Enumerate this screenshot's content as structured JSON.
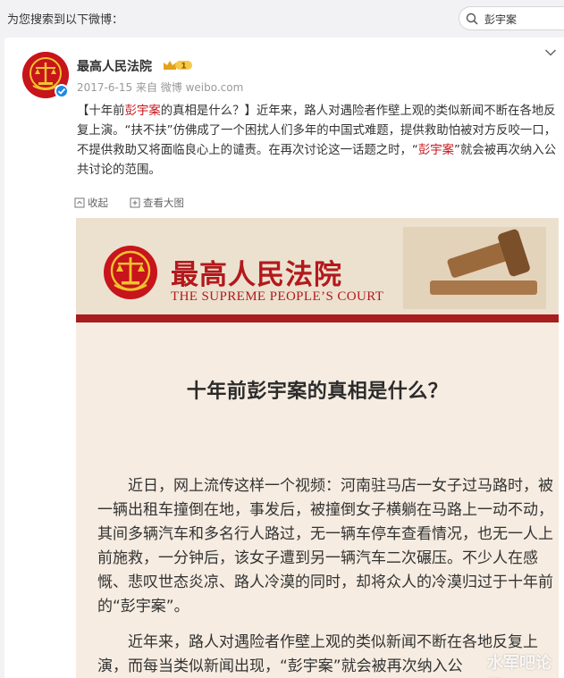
{
  "top_bar": {
    "label": "为您搜索到以下微博：",
    "search_value": "彭宇案"
  },
  "post": {
    "username": "最高人民法院",
    "badge_level": "1",
    "date": "2017-6-15",
    "source": "来自 微博 weibo.com",
    "text_segments": [
      "【十年前",
      "彭宇案",
      "的真相是什么？】近年来，路人对遇险者作壁上观的类似新闻不断在各地反复上演。“扶不扶”仿佛成了一个困扰人们多年的中国式难题，提供救助怕被对方反咬一口，不提供救助又将面临良心上的谴责。在再次讨论这一话题之时，“",
      "彭宇案",
      "”就会被再次纳入公共讨论的范围。"
    ],
    "actions": {
      "collapse": "收起",
      "view_large": "查看大图"
    }
  },
  "article_image": {
    "court_cn": "最高人民法院",
    "court_en": "THE SUPREME PEOPLE’S COURT",
    "title": "十年前彭宇案的真相是什么？",
    "para1": "近日，网上流传这样一个视频：河南驻马店一女子过马路时，被一辆出租车撞倒在地，事发后，被撞倒女子横躺在马路上一动不动，其间多辆汽车和多名行人路过，无一辆车停车查看情况，也无一人上前施救，一分钟后，该女子遭到另一辆汽车二次碾压。不少人在感慨、悲叹世态炎凉、路人冷漠的同时，却将众人的冷漠归过于十年前的“彭宇案”。",
    "para2": "近年来，路人对遇险者作壁上观的类似新闻不断在各地反复上演，而每当类似新闻出现，“彭宇案”就会被再次纳入公",
    "watermark": "水军吧论坛"
  },
  "colors": {
    "brand_red": "#c8141b",
    "article_bg": "#f6ece1"
  }
}
